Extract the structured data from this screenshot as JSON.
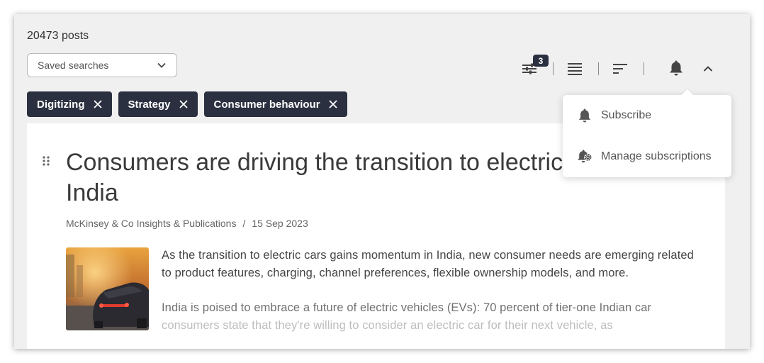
{
  "header": {
    "posts_count": "20473 posts",
    "saved_searches_label": "Saved searches"
  },
  "filters": [
    {
      "label": "Digitizing"
    },
    {
      "label": "Strategy"
    },
    {
      "label": "Consumer behaviour"
    }
  ],
  "toolbar": {
    "filter_badge": "3",
    "icons": [
      "filter-sliders-icon",
      "list-view-icon",
      "sort-icon",
      "bell-icon",
      "chevron-up-icon"
    ]
  },
  "notification_menu": {
    "items": [
      {
        "label": "Subscribe",
        "icon": "bell-icon"
      },
      {
        "label": "Manage subscriptions",
        "icon": "bell-gear-icon"
      }
    ]
  },
  "article": {
    "title": "Consumers are driving the transition to electric cars in India",
    "source": "McKinsey & Co Insights & Publications",
    "separator": "/",
    "date": "15 Sep 2023",
    "summary": "As the transition to electric cars gains momentum in India, new consumer needs are emerging related to product features, charging, channel preferences, flexible ownership models, and more.",
    "excerpt_line1": "India is poised to embrace a future of electric vehicles (EVs): 70 percent of tier-one Indian car",
    "excerpt_line2": "consumers state that they're willing to consider an electric car for their next vehicle, as"
  },
  "colors": {
    "chip_bg": "#2b3040",
    "frame_bg": "#f0f0f0",
    "text_dark": "#3a3a3a"
  }
}
